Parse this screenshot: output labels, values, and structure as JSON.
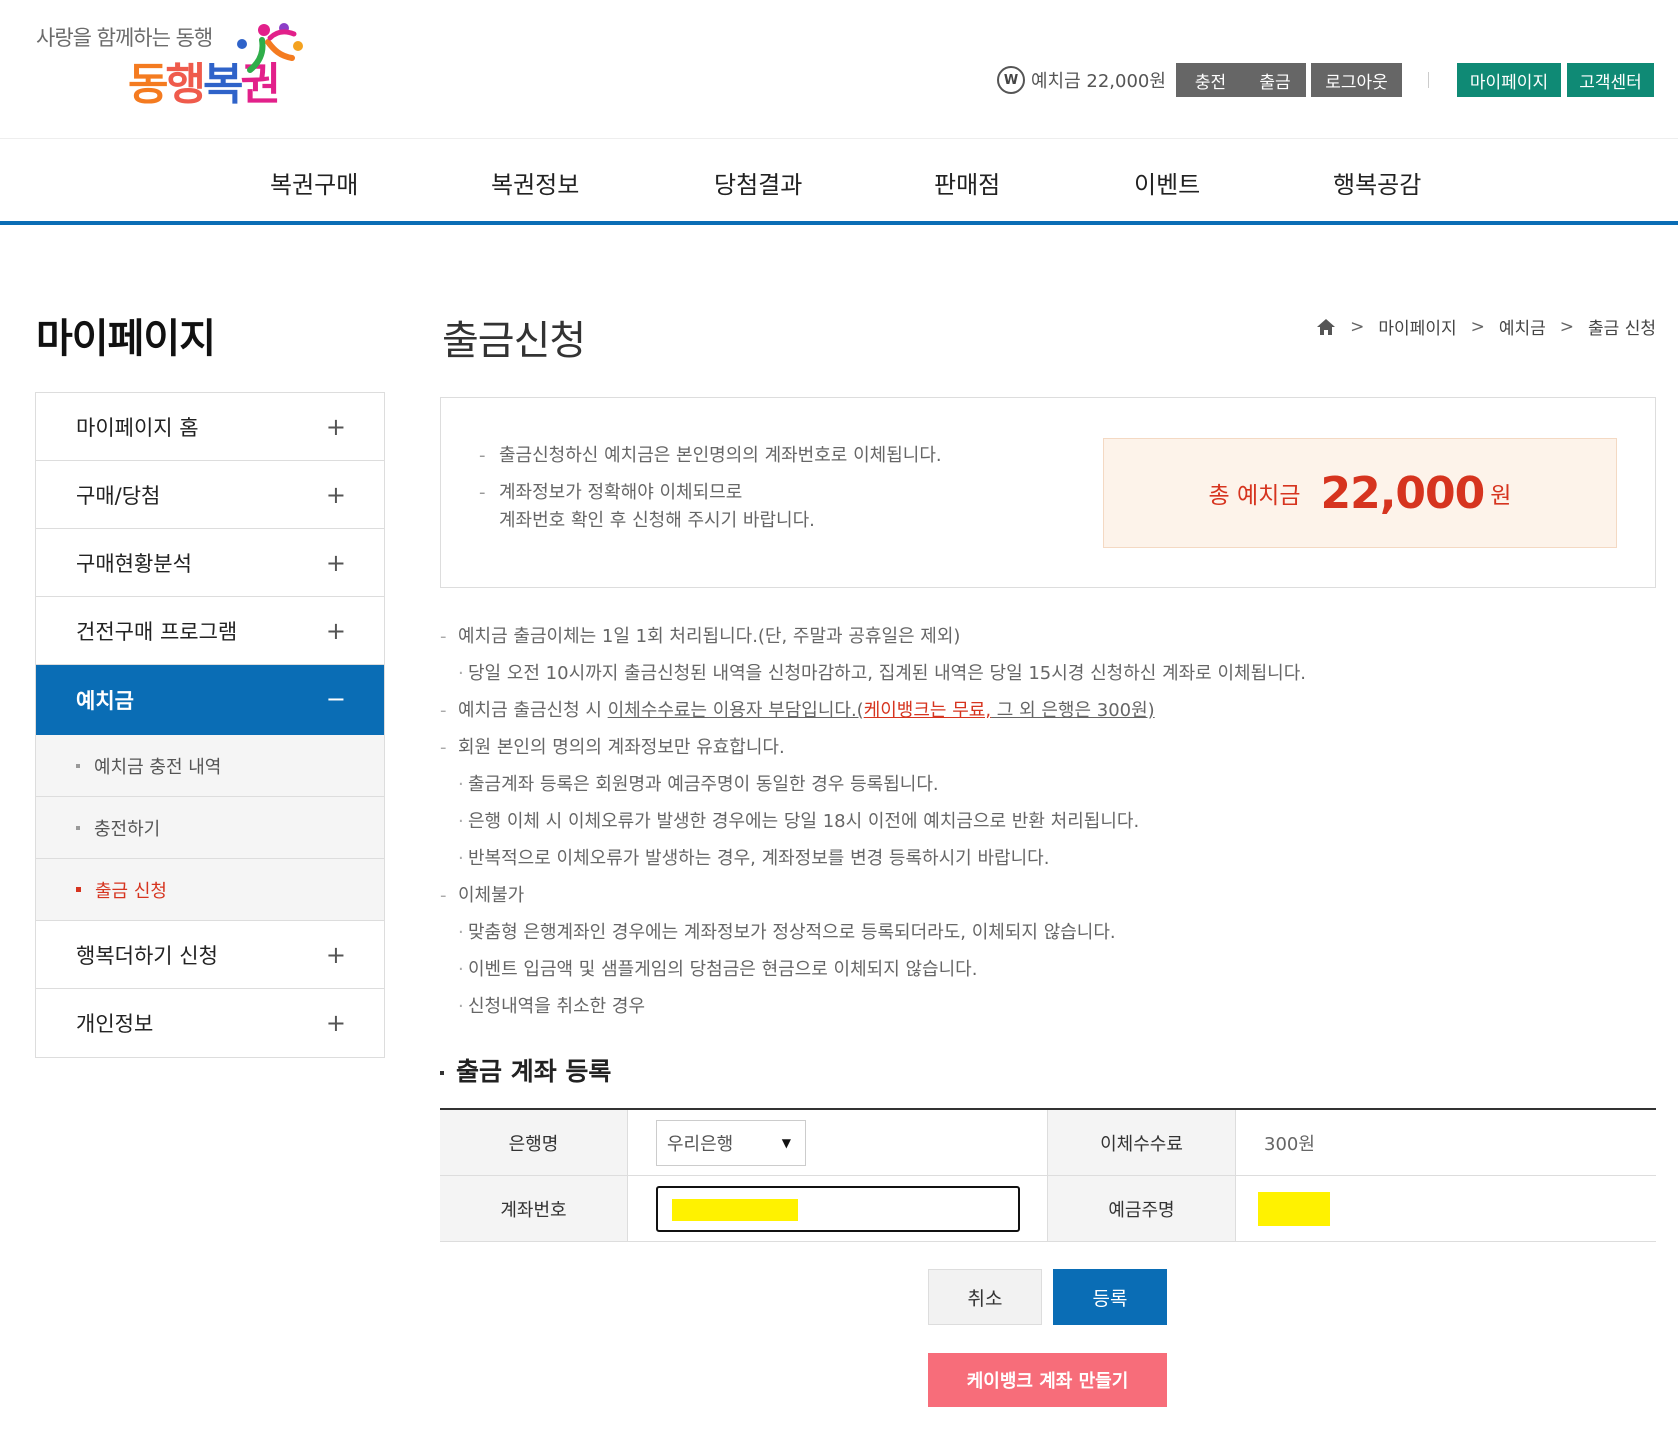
{
  "header": {
    "logo": {
      "slogan": "사랑을 함께하는 동행",
      "name_parts": [
        "동",
        "행",
        "복",
        "권"
      ]
    },
    "deposit_icon": "W",
    "deposit_text": "예치금 22,000원",
    "buttons": {
      "charge": "충전",
      "withdraw": "출금",
      "logout": "로그아웃",
      "mypage": "마이페이지",
      "support": "고객센터"
    }
  },
  "gnb": [
    "복권구매",
    "복권정보",
    "당첨결과",
    "판매점",
    "이벤트",
    "행복공감"
  ],
  "sidebar": {
    "title": "마이페이지",
    "items": [
      {
        "label": "마이페이지 홈",
        "sign": "+"
      },
      {
        "label": "구매/당첨",
        "sign": "+"
      },
      {
        "label": "구매현황분석",
        "sign": "+"
      },
      {
        "label": "건전구매 프로그램",
        "sign": "+"
      },
      {
        "label": "예치금",
        "sign": "−"
      },
      {
        "label": "행복더하기 신청",
        "sign": "+"
      },
      {
        "label": "개인정보",
        "sign": "+"
      }
    ],
    "subitems": [
      "예치금 충전 내역",
      "충전하기",
      "출금 신청"
    ]
  },
  "page": {
    "title": "출금신청",
    "breadcrumb": [
      "마이페이지",
      "예치금",
      "출금 신청"
    ]
  },
  "info": {
    "lines": [
      "출금신청하신 예치금은 본인명의의 계좌번호로 이체됩니다.",
      "계좌정보가 정확해야 이체되므로",
      "계좌번호 확인 후 신청해 주시기 바랍니다."
    ],
    "total_label": "총 예치금",
    "total_amount": "22,000",
    "total_unit": "원"
  },
  "notes": {
    "n1": "예치금 출금이체는 1일 1회 처리됩니다.(단, 주말과 공휴일은 제외)",
    "n1a": "당일 오전 10시까지 출금신청된 내역을 신청마감하고, 집계된 내역은 당일 15시경 신청하신 계좌로 이체됩니다.",
    "n2_pre": "예치금 출금신청 시 ",
    "n2_u1": "이체수수료는 이용자 부담입니다.(",
    "n2_red": "케이뱅크는 무료,",
    "n2_u2": " 그 외 은행은 300원)",
    "n3": "회원 본인의 명의의 계좌정보만 유효합니다.",
    "n3a": "출금계좌 등록은 회원명과 예금주명이 동일한 경우 등록됩니다.",
    "n3b": "은행 이체 시 이체오류가 발생한 경우에는 당일 18시 이전에 예치금으로 반환 처리됩니다.",
    "n3c": "반복적으로 이체오류가 발생하는 경우, 계좌정보를 변경 등록하시기 바랍니다.",
    "n4": "이체불가",
    "n4a": "맞춤형 은행계좌인 경우에는 계좌정보가 정상적으로 등록되더라도, 이체되지 않습니다.",
    "n4b": "이벤트 입금액 및 샘플게임의 당첨금은 현금으로 이체되지 않습니다.",
    "n4c": "신청내역을 취소한 경우"
  },
  "form": {
    "section_title": "출금 계좌 등록",
    "bank_label": "은행명",
    "bank_value": "우리은행",
    "fee_label": "이체수수료",
    "fee_value": "300원",
    "account_label": "계좌번호",
    "holder_label": "예금주명"
  },
  "buttons": {
    "cancel": "취소",
    "submit": "등록",
    "kbank": "케이뱅크 계좌 만들기"
  },
  "colors": {
    "primary": "#0a6db5",
    "green": "#0f8a75",
    "accent_red": "#d6341f",
    "kbank_pink": "#f76d7a",
    "mask_yellow": "#fff200"
  }
}
